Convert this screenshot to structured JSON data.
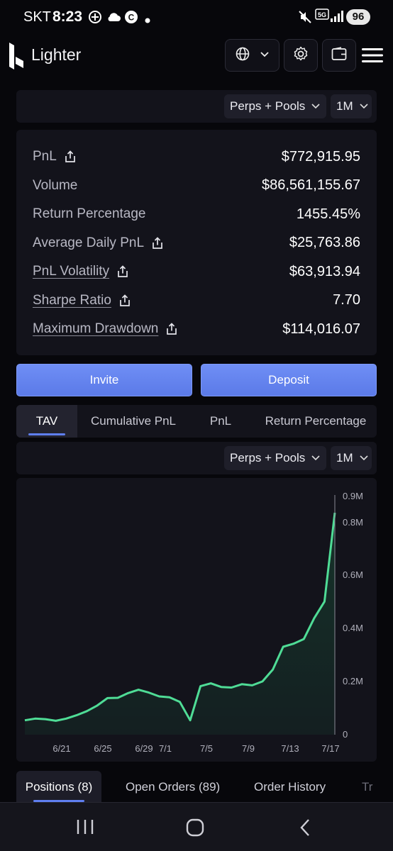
{
  "status_bar": {
    "carrier": "SKT",
    "time": "8:23",
    "network": "5G",
    "battery": "96"
  },
  "header": {
    "brand": "Lighter",
    "icons": [
      "globe-icon",
      "chevron-down-icon",
      "gear-icon",
      "wallet-icon",
      "menu-icon"
    ]
  },
  "filter_top": {
    "market_select": "Perps + Pools",
    "range_select": "1M"
  },
  "stats": [
    {
      "label": "PnL",
      "value": "$772,915.95",
      "share": true,
      "link": false
    },
    {
      "label": "Volume",
      "value": "$86,561,155.67",
      "share": false,
      "link": false
    },
    {
      "label": "Return Percentage",
      "value": "1455.45%",
      "share": false,
      "link": false
    },
    {
      "label": "Average Daily PnL",
      "value": "$25,763.86",
      "share": true,
      "link": false
    },
    {
      "label": "PnL Volatility",
      "value": "$63,913.94",
      "share": true,
      "link": true
    },
    {
      "label": "Sharpe Ratio",
      "value": "7.70",
      "share": true,
      "link": true
    },
    {
      "label": "Maximum Drawdown",
      "value": "$114,016.07",
      "share": true,
      "link": true
    }
  ],
  "actions": {
    "invite": "Invite",
    "deposit": "Deposit"
  },
  "chart_tabs": [
    "TAV",
    "Cumulative PnL",
    "PnL",
    "Return Percentage"
  ],
  "active_chart_tab": "TAV",
  "filter_chart": {
    "market_select": "Perps + Pools",
    "range_select": "1M"
  },
  "chart_data": {
    "type": "area",
    "line_color": "#4fdc96",
    "fill_color": "#16352b",
    "x_ticks": [
      "6/21",
      "6/25",
      "6/29",
      "7/1",
      "7/5",
      "7/9",
      "7/13",
      "7/17"
    ],
    "y_ticks": [
      "0",
      "0.2M",
      "0.4M",
      "0.6M",
      "0.8M",
      "0.9M"
    ],
    "ylim": [
      0,
      900000
    ],
    "x": [
      "6/18",
      "6/19",
      "6/20",
      "6/21",
      "6/22",
      "6/23",
      "6/24",
      "6/25",
      "6/26",
      "6/27",
      "6/28",
      "6/29",
      "6/30",
      "7/1",
      "7/2",
      "7/3",
      "7/4",
      "7/5",
      "7/6",
      "7/7",
      "7/8",
      "7/9",
      "7/10",
      "7/11",
      "7/12",
      "7/13",
      "7/14",
      "7/15",
      "7/16",
      "7/17"
    ],
    "values": [
      52000,
      58000,
      56000,
      50000,
      58000,
      70000,
      85000,
      105000,
      132000,
      133000,
      150000,
      162000,
      152000,
      138000,
      135000,
      118000,
      52000,
      175000,
      185000,
      172000,
      170000,
      182000,
      178000,
      192000,
      235000,
      317000,
      328000,
      345000,
      420000,
      480000,
      800000
    ],
    "xlabel": "",
    "ylabel": ""
  },
  "bottom_tabs": [
    "Positions (8)",
    "Open Orders (89)",
    "Order History",
    "Tr"
  ],
  "active_bottom_tab": "Positions (8)",
  "nav": [
    "recent-apps-icon",
    "home-icon",
    "back-icon"
  ]
}
